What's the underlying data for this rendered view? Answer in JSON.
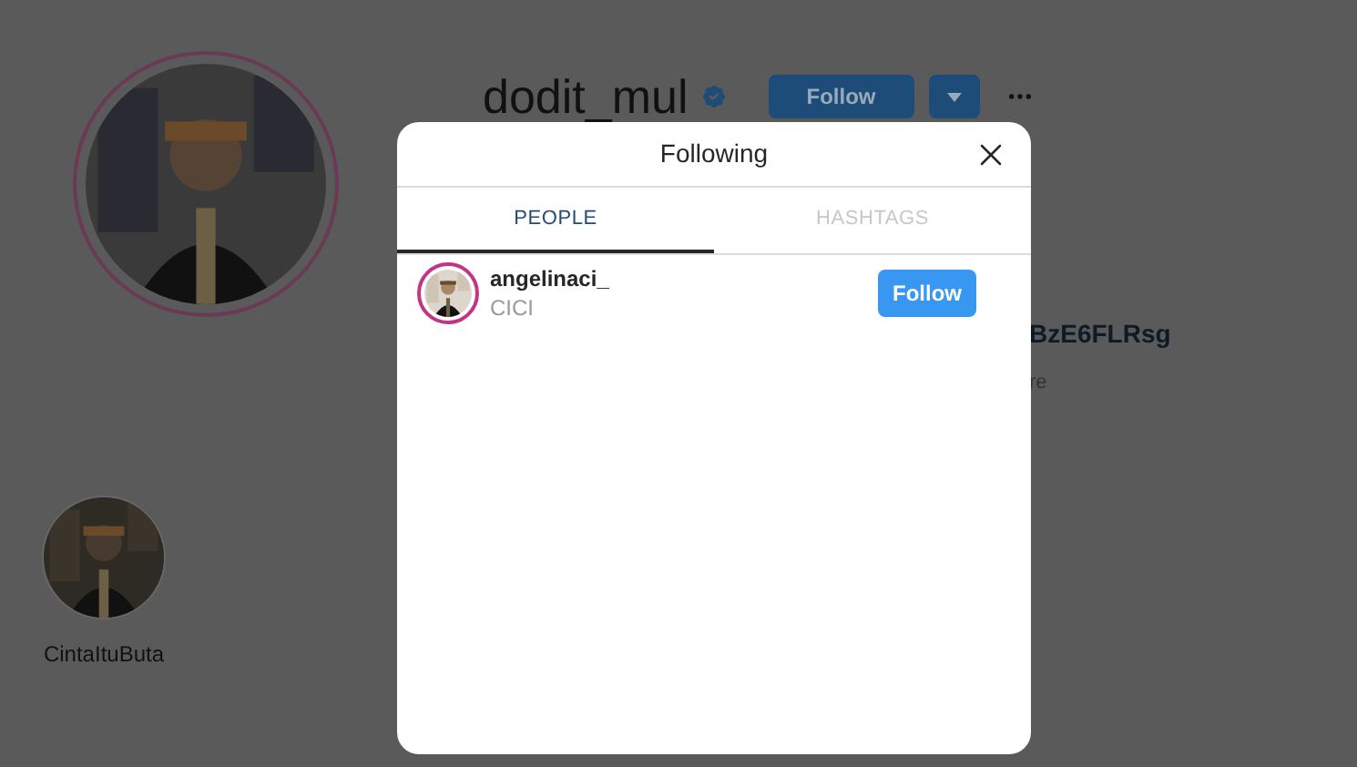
{
  "profile": {
    "username": "dodit_mul",
    "verified": true,
    "follow_button": "Follow",
    "partial_texts": [
      "BzE6FLRsg",
      "re"
    ]
  },
  "highlights": [
    {
      "label": "CintaItuButa"
    }
  ],
  "modal": {
    "title": "Following",
    "tabs": [
      {
        "label": "PEOPLE",
        "selected": true
      },
      {
        "label": "HASHTAGS",
        "selected": false
      }
    ],
    "people": [
      {
        "username": "angelinaci_",
        "name": "CICI",
        "button": "Follow"
      }
    ]
  }
}
